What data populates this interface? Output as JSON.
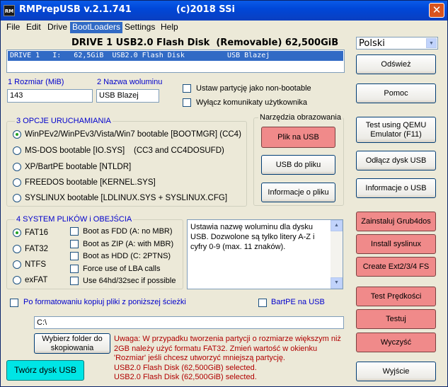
{
  "window": {
    "title": "RMPrepUSB v.2.1.741",
    "copyright": "(c)2018 SSi",
    "app_icon_text": "RM",
    "close_glyph": "✕"
  },
  "menu": [
    "File",
    "Edit",
    "Drive",
    "BootLoaders",
    "Settings",
    "Help"
  ],
  "drive_title": "DRIVE 1 USB2.0 Flash Disk  (Removable) 62,500GiB",
  "language": {
    "selected": "Polski",
    "arrow": "▼"
  },
  "drive_list": [
    "DRIVE 1   I:   62,5GiB  USB2.0 Flash Disk          USB Blazej"
  ],
  "size": {
    "label": "1 Rozmiar (MiB)",
    "value": "143"
  },
  "volume": {
    "label": "2 Nazwa woluminu",
    "value": "USB Blazej"
  },
  "options_top": [
    "Ustaw partycję jako non-bootable",
    "Wyłącz komunikaty użytkownika"
  ],
  "boot": {
    "title": "3 OPCJE URUCHAMIANIA",
    "options": [
      "WinPEv2/WinPEv3/Vista/Win7 bootable [BOOTMGR] (CC4)",
      "MS-DOS bootable [IO.SYS]    (CC3 and CC4DOSUFD)",
      "XP/BartPE bootable [NTLDR]",
      "FREEDOS bootable [KERNEL.SYS]",
      "SYSLINUX bootable [LDLINUX.SYS + SYSLINUX.CFG]"
    ],
    "selected_index": 0
  },
  "image_tools": {
    "title": "Narzędzia obrazowania",
    "file_to_usb": "Plik na USB",
    "usb_to_file": "USB do pliku",
    "file_info": "Informacje o pliku"
  },
  "fs": {
    "title": "4 SYSTEM PLIKÓW i OBEJŚCIA",
    "types": [
      "FAT16",
      "FAT32",
      "NTFS",
      "exFAT"
    ],
    "selected_index": 0,
    "options": [
      "Boot as FDD (A: no MBR)",
      "Boot as ZIP (A: with MBR)",
      "Boot as HDD (C: 2PTNS)",
      "Force use of LBA calls",
      "Use 64hd/32sec if possible"
    ]
  },
  "memo": "Ustawia nazwę woluminu dla dysku USB. Dozwolone są tylko litery A-Z i cyfry 0-9 (max. 11 znaków).",
  "copy_after_format": "Po formatowaniu kopiuj pliki z poniższej ścieżki",
  "bartpe": "BartPE na USB",
  "path": "C:\\",
  "choose_folder": "Wybierz folder do skopiowania",
  "make_usb": "Twórz dysk USB",
  "messages": [
    "Uwaga: W przypadku tworzenia partycji o rozmiarze większym niż 2GB należy użyć formatu FAT32. Zmień wartość w okienku 'Rozmiar' jeśli chcesz utworzyć mniejszą partycję.",
    "USB2.0 Flash Disk (62,500GiB) selected.",
    "USB2.0 Flash Disk (62,500GiB) selected."
  ],
  "right_buttons": {
    "refresh": "Odśwież",
    "help": "Pomoc",
    "qemu": "Test using QEMU Emulator (F11)",
    "eject": "Odłącz dysk USB",
    "usb_info": "Informacje o USB",
    "grub4dos": "Zainstaluj Grub4dos",
    "syslinux": "Install syslinux",
    "ext": "Create Ext2/3/4 FS",
    "speed": "Test Prędkości",
    "test": "Testuj",
    "wipe": "Wyczyść",
    "exit": "Wyjście"
  },
  "colors": {
    "pink_button": "#F08A8A",
    "cyan_button": "#00E5E5",
    "selection": "#316AC5",
    "label_blue": "#0000CC",
    "message_red": "#B00000"
  }
}
